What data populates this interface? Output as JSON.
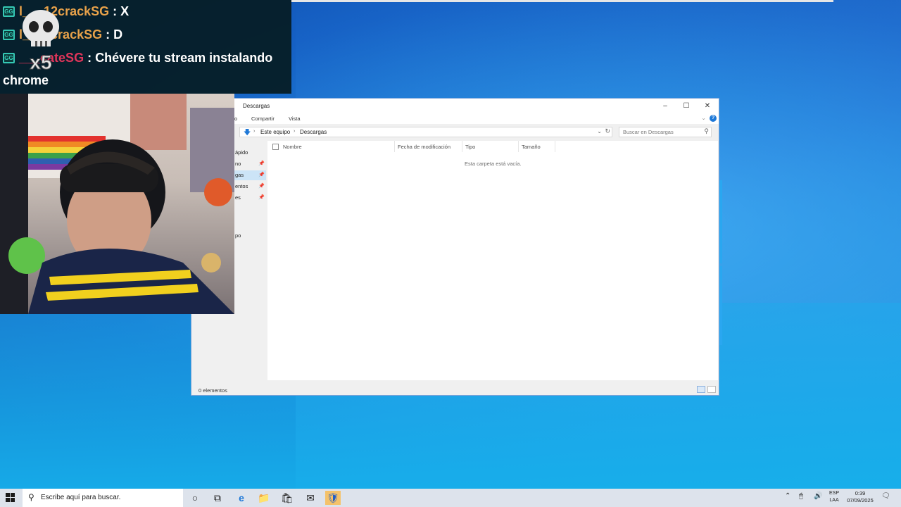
{
  "chat": {
    "lines": [
      {
        "badge": "GG",
        "user": "l___12crackSG",
        "sep": ":",
        "msg": "X"
      },
      {
        "badge": "GG",
        "user": "l___2crackSG",
        "sep": ":",
        "msg": "D"
      },
      {
        "badge": "GG",
        "user": "___cateSG",
        "sep": ":",
        "msg": "Chévere tu stream instalando"
      }
    ],
    "wrap": "chrome",
    "skull_label": "x5"
  },
  "explorer": {
    "title": "Descargas",
    "ribbon": {
      "tab_partial": "o",
      "share": "Compartir",
      "view": "Vista"
    },
    "address": {
      "crumb1": "Este equipo",
      "crumb2": "Descargas"
    },
    "search_placeholder": "Buscar en Descargas",
    "columns": {
      "name": "Nombre",
      "modified": "Fecha de modificación",
      "type": "Tipo",
      "size": "Tamaño"
    },
    "empty_message": "Esta carpeta está vacía.",
    "nav": [
      "ápido",
      "no",
      "gas",
      "entos",
      "es",
      "po"
    ],
    "status": "0 elementos"
  },
  "taskbar": {
    "search_placeholder": "Escribe aquí para buscar.",
    "lang_line1": "ESP",
    "lang_line2": "LAA",
    "time": "0:39",
    "date": "07/09/2025"
  },
  "colors": {
    "desktop": "#1560c4",
    "taskbar": "#dde3ec",
    "chat_bg": "#061e28",
    "badge": "#35c9b5",
    "user_orange": "#e8a24a",
    "user_red": "#e0355a",
    "accent": "#1e78d7"
  }
}
